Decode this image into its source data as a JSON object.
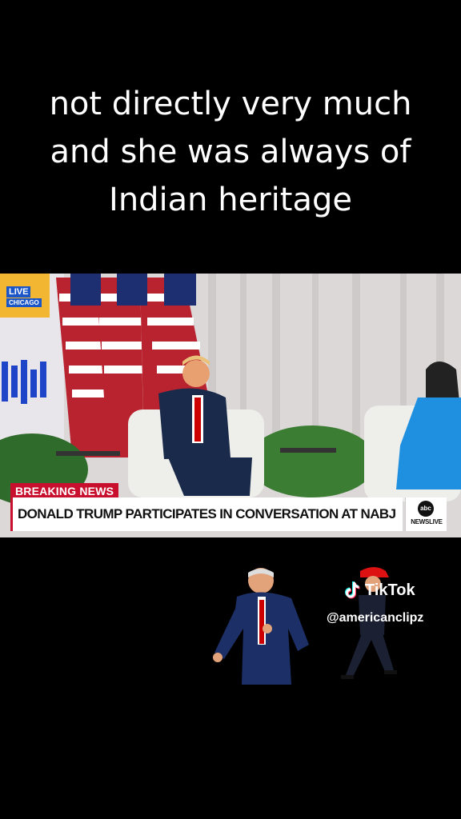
{
  "caption": "not directly very much and she was always of Indian heritage",
  "video": {
    "live_label": "LIVE",
    "location": "CHICAGO",
    "breaking_label": "BREAKING NEWS",
    "headline": "DONALD TRUMP PARTICIPATES IN CONVERSATION AT NABJ",
    "network_logo": "abc",
    "network_sub": "NEWSLIVE"
  },
  "watermark": {
    "app_name": "TikTok",
    "handle": "@americanclipz",
    "icon": "tiktok-note-icon"
  },
  "colors": {
    "background": "#000000",
    "breaking_red": "#c8102e",
    "live_blue": "#1a56c8",
    "speaker_suit_blue": "#1f8fe0"
  }
}
